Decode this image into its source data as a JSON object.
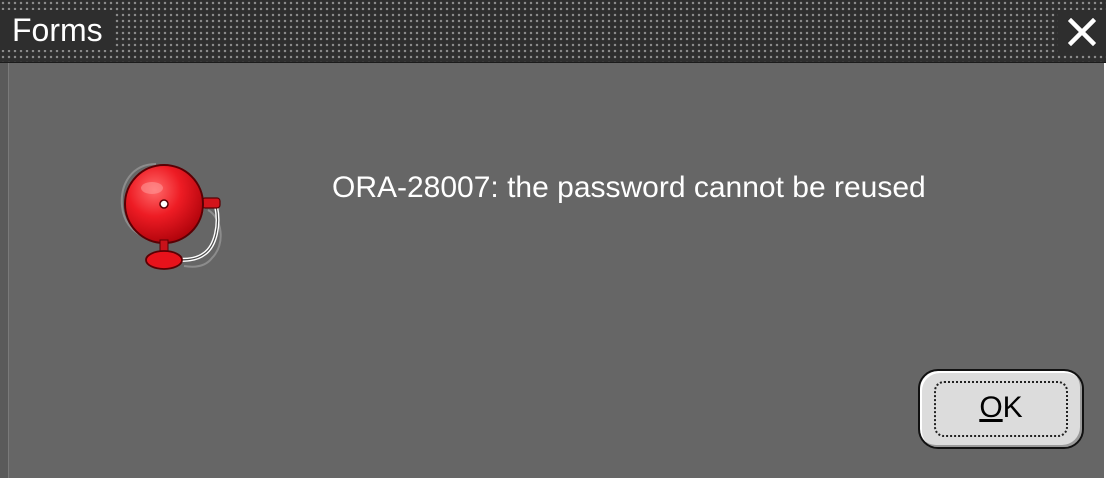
{
  "window": {
    "title": "Forms",
    "close_icon": "close-icon"
  },
  "dialog": {
    "icon": "alarm-bell-icon",
    "message": "ORA-28007: the password cannot be reused",
    "ok_button": {
      "mnemonic": "O",
      "rest": "K"
    }
  },
  "colors": {
    "dialog_background": "#666666",
    "titlebar_background": "#2e2e2e",
    "bell_red": "#e8121b",
    "button_face": "#dcdcdc",
    "text": "#ffffff"
  }
}
